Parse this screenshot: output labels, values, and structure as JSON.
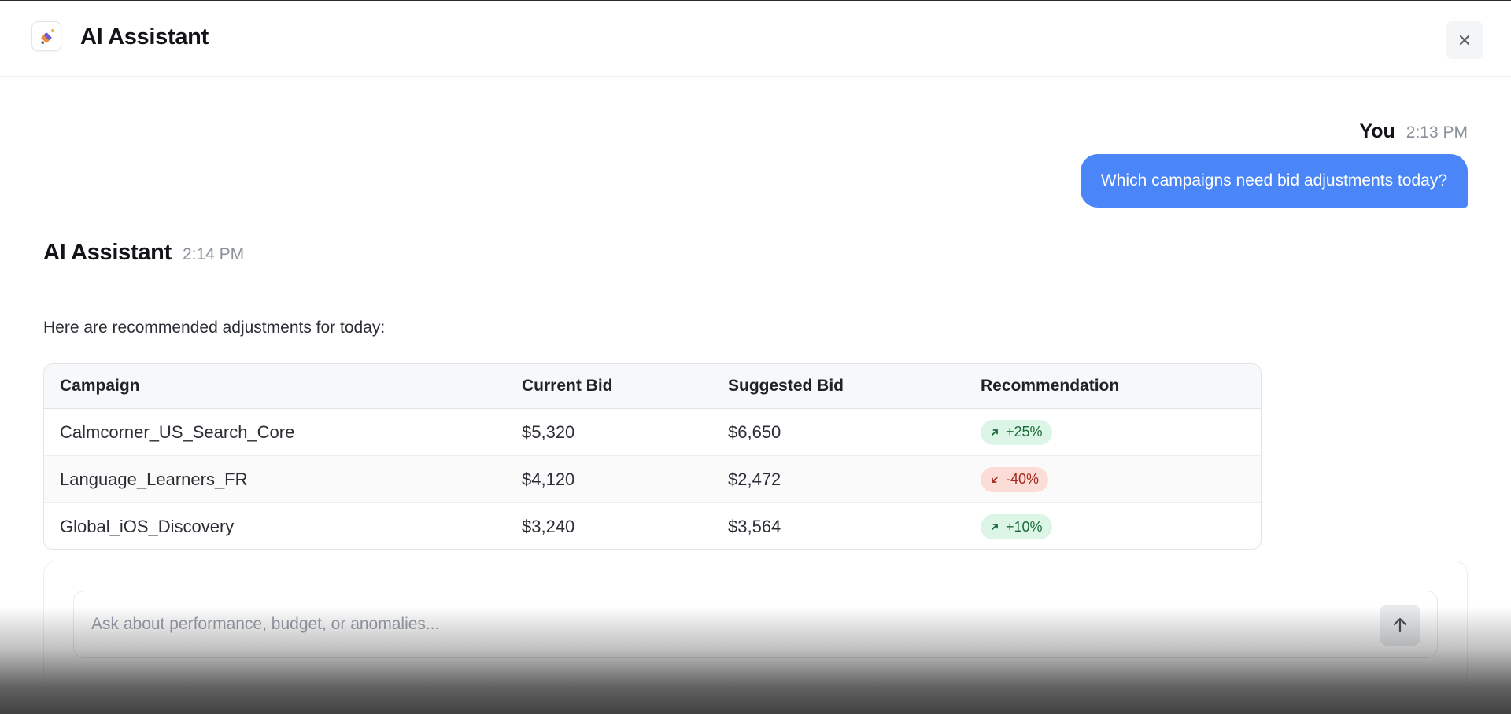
{
  "header": {
    "app_title": "AI Assistant",
    "logo_icon": "sparkle-pencil-icon",
    "close_label": "×"
  },
  "user_message": {
    "sender": "You",
    "time": "2:13 PM",
    "text": "Which campaigns need bid adjustments today?"
  },
  "ai_message": {
    "sender": "AI Assistant",
    "time": "2:14 PM",
    "intro": "Here are recommended adjustments for today:"
  },
  "table": {
    "headers": [
      "Campaign",
      "Current Bid",
      "Suggested Bid",
      "Recommendation"
    ],
    "rows": [
      {
        "campaign": "Calmcorner_US_Search_Core",
        "current_bid": "$5,320",
        "suggested_bid": "$6,650",
        "recommendation": "+25%",
        "direction": "up"
      },
      {
        "campaign": "Language_Learners_FR",
        "current_bid": "$4,120",
        "suggested_bid": "$2,472",
        "recommendation": "-40%",
        "direction": "down"
      },
      {
        "campaign": "Global_iOS_Discovery",
        "current_bid": "$3,240",
        "suggested_bid": "$3,564",
        "recommendation": "+10%",
        "direction": "up"
      }
    ]
  },
  "composer": {
    "placeholder": "Ask about performance, budget, or anomalies...",
    "value": "",
    "send_icon": "arrow-up-icon"
  },
  "colors": {
    "accent": "#4a86f7",
    "up_bg": "#dcf5e6",
    "up_text": "#1b6b3a",
    "down_bg": "#fbdcd6",
    "down_text": "#a3281b"
  }
}
